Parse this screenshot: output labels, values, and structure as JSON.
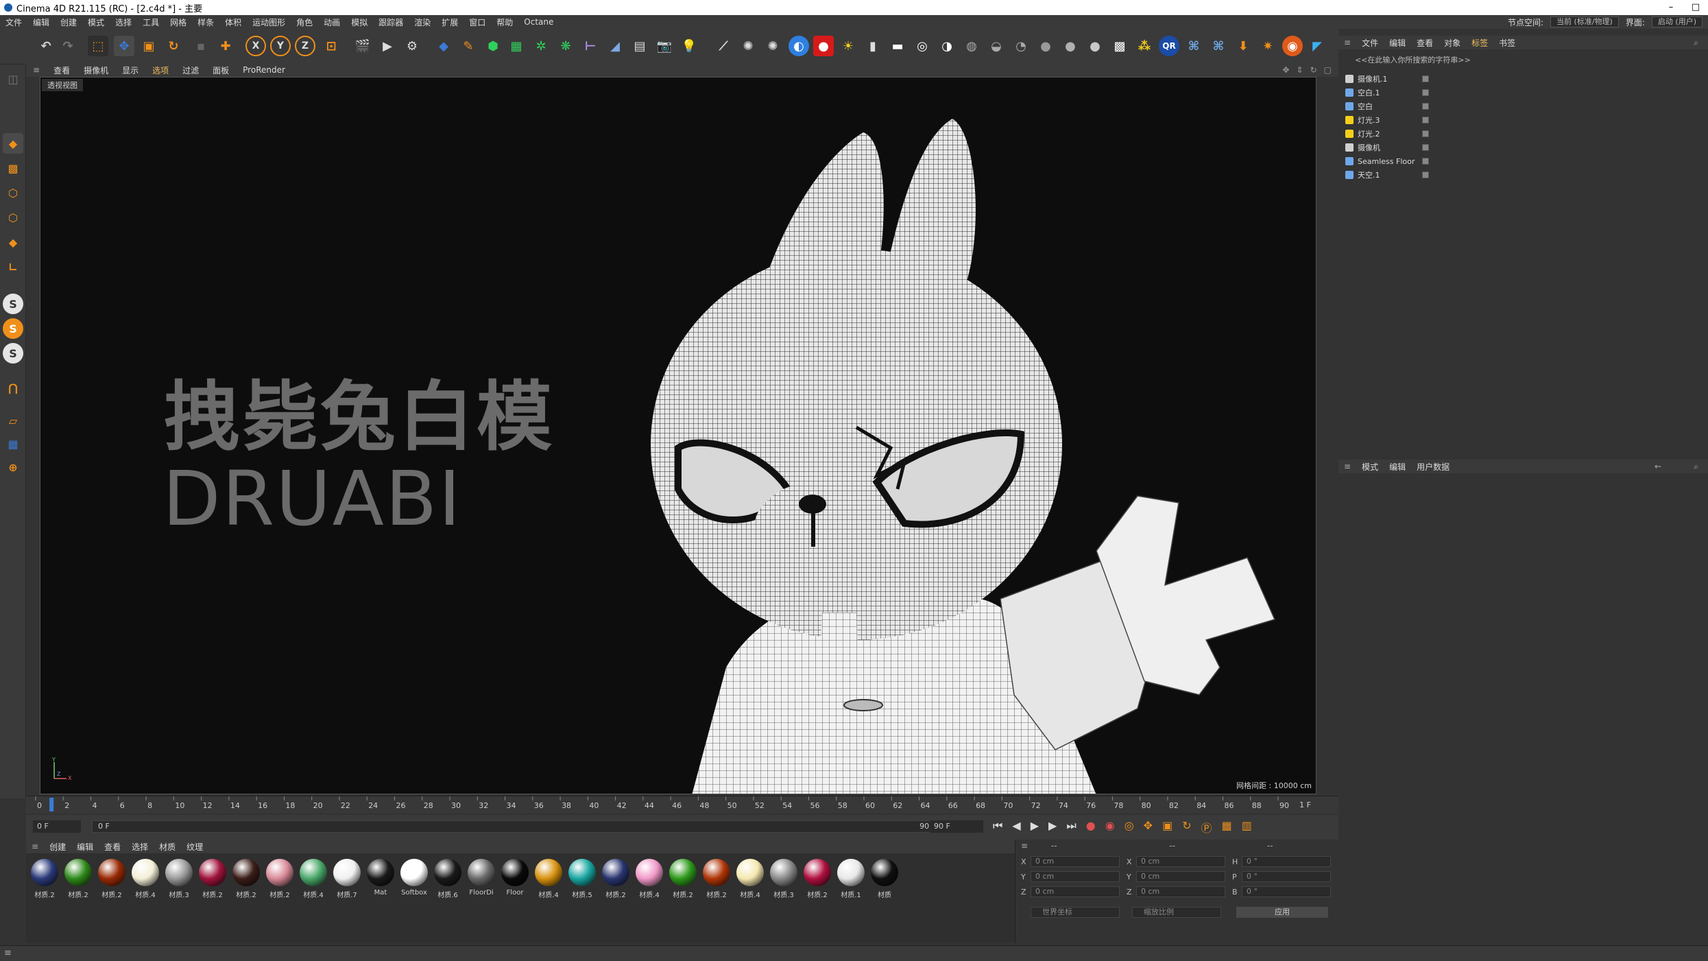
{
  "window": {
    "title": "Cinema 4D R21.115 (RC) - [2.c4d *] - 主要",
    "minimize": "–",
    "maximize": "□"
  },
  "menubar": {
    "items": [
      "文件",
      "编辑",
      "创建",
      "模式",
      "选择",
      "工具",
      "网格",
      "样条",
      "体积",
      "运动图形",
      "角色",
      "动画",
      "模拟",
      "跟踪器",
      "渲染",
      "扩展",
      "窗口",
      "帮助",
      "Octane"
    ],
    "node_space_label": "节点空间:",
    "node_space_value": "当前 (标准/物理)",
    "layout_label": "界面:",
    "layout_value": "启动 (用户)"
  },
  "viewport_menu": {
    "items": [
      "查看",
      "摄像机",
      "显示",
      "选项",
      "过滤",
      "面板",
      "ProRender"
    ],
    "label": "透视视图",
    "overlay_title": "拽毙兔白模",
    "overlay_subtitle": "DRUABI",
    "grid_info": "网格间距 : 10000 cm"
  },
  "timeline": {
    "ticks": [
      "0",
      "2",
      "4",
      "6",
      "8",
      "10",
      "12",
      "14",
      "16",
      "18",
      "20",
      "22",
      "24",
      "26",
      "28",
      "30",
      "32",
      "34",
      "36",
      "38",
      "40",
      "42",
      "44",
      "46",
      "48",
      "50",
      "52",
      "54",
      "56",
      "58",
      "60",
      "62",
      "64",
      "66",
      "68",
      "70",
      "72",
      "74",
      "76",
      "78",
      "80",
      "82",
      "84",
      "86",
      "88",
      "90"
    ],
    "current_frame": "1 F",
    "start": "0 F",
    "min": "0 F",
    "max": "90 F",
    "end": "90 F"
  },
  "material_menu": {
    "items": [
      "创建",
      "编辑",
      "查看",
      "选择",
      "材质",
      "纹理"
    ]
  },
  "materials": [
    {
      "name": "材质.2",
      "color": "#2b3a7a"
    },
    {
      "name": "材质.2",
      "color": "#2e8a1a"
    },
    {
      "name": "材质.2",
      "color": "#9a2a05"
    },
    {
      "name": "材质.4",
      "color": "#f3efd7"
    },
    {
      "name": "材质.3",
      "color": "#9a9a9a"
    },
    {
      "name": "材质.2",
      "color": "#a0143c"
    },
    {
      "name": "材质.2",
      "color": "#3b1e18"
    },
    {
      "name": "材质.2",
      "color": "#d98a98"
    },
    {
      "name": "材质.4",
      "color": "#4aa86a"
    },
    {
      "name": "材质.7",
      "color": "#f0f0f0"
    },
    {
      "name": "Mat",
      "color": "#1a1a1a"
    },
    {
      "name": "Softbox",
      "color": "#ffffff"
    },
    {
      "name": "材质.6",
      "color": "#1a1a1a"
    },
    {
      "name": "FloorDi",
      "color": "#6a6a6a"
    },
    {
      "name": "Floor",
      "color": "#0a0a0a"
    },
    {
      "name": "材质.4",
      "color": "#d8920f"
    },
    {
      "name": "材质.5",
      "color": "#1aa6a0"
    },
    {
      "name": "材质.2",
      "color": "#2a3570"
    },
    {
      "name": "材质.4",
      "color": "#f199c8"
    },
    {
      "name": "材质.2",
      "color": "#2e9a1a"
    },
    {
      "name": "材质.2",
      "color": "#b03508"
    },
    {
      "name": "材质.4",
      "color": "#f5e8b0"
    },
    {
      "name": "材质.3",
      "color": "#8a8a8a"
    },
    {
      "name": "材质.2",
      "color": "#b01040"
    },
    {
      "name": "材质.1",
      "color": "#e8e8e8"
    },
    {
      "name": "材质",
      "color": "#101010"
    }
  ],
  "coordinates": {
    "rows": [
      {
        "axis": "X",
        "pos": "0 cm",
        "axis2": "X",
        "size": "0 cm",
        "axis3": "H",
        "rot": "0 °"
      },
      {
        "axis": "Y",
        "pos": "0 cm",
        "axis2": "Y",
        "size": "0 cm",
        "axis3": "P",
        "rot": "0 °"
      },
      {
        "axis": "Z",
        "pos": "0 cm",
        "axis2": "Z",
        "size": "0 cm",
        "axis3": "B",
        "rot": "0 °"
      }
    ],
    "mode_world": "世界坐标",
    "mode_scale": "缩放比例",
    "apply": "应用"
  },
  "object_manager": {
    "menu": [
      "文件",
      "编辑",
      "查看",
      "对象",
      "标签",
      "书签"
    ],
    "search_placeholder": "<<在此输入你所搜索的字符串>>",
    "objects": [
      {
        "name": "摄像机.1",
        "icon": "camera-icon"
      },
      {
        "name": "空白.1",
        "icon": "null-icon"
      },
      {
        "name": "空白",
        "icon": "null-icon"
      },
      {
        "name": "灯光.3",
        "icon": "light-icon"
      },
      {
        "name": "灯光.2",
        "icon": "light-icon"
      },
      {
        "name": "摄像机",
        "icon": "camera-icon"
      },
      {
        "name": "Seamless Floor",
        "icon": "floor-icon"
      },
      {
        "name": "天空.1",
        "icon": "sky-icon"
      }
    ]
  },
  "attribute_manager": {
    "menu": [
      "模式",
      "编辑",
      "用户数据"
    ]
  },
  "colors": {
    "accent_blue": "#3b7bd6",
    "accent_orange": "#f0901a",
    "background": "#333333"
  }
}
